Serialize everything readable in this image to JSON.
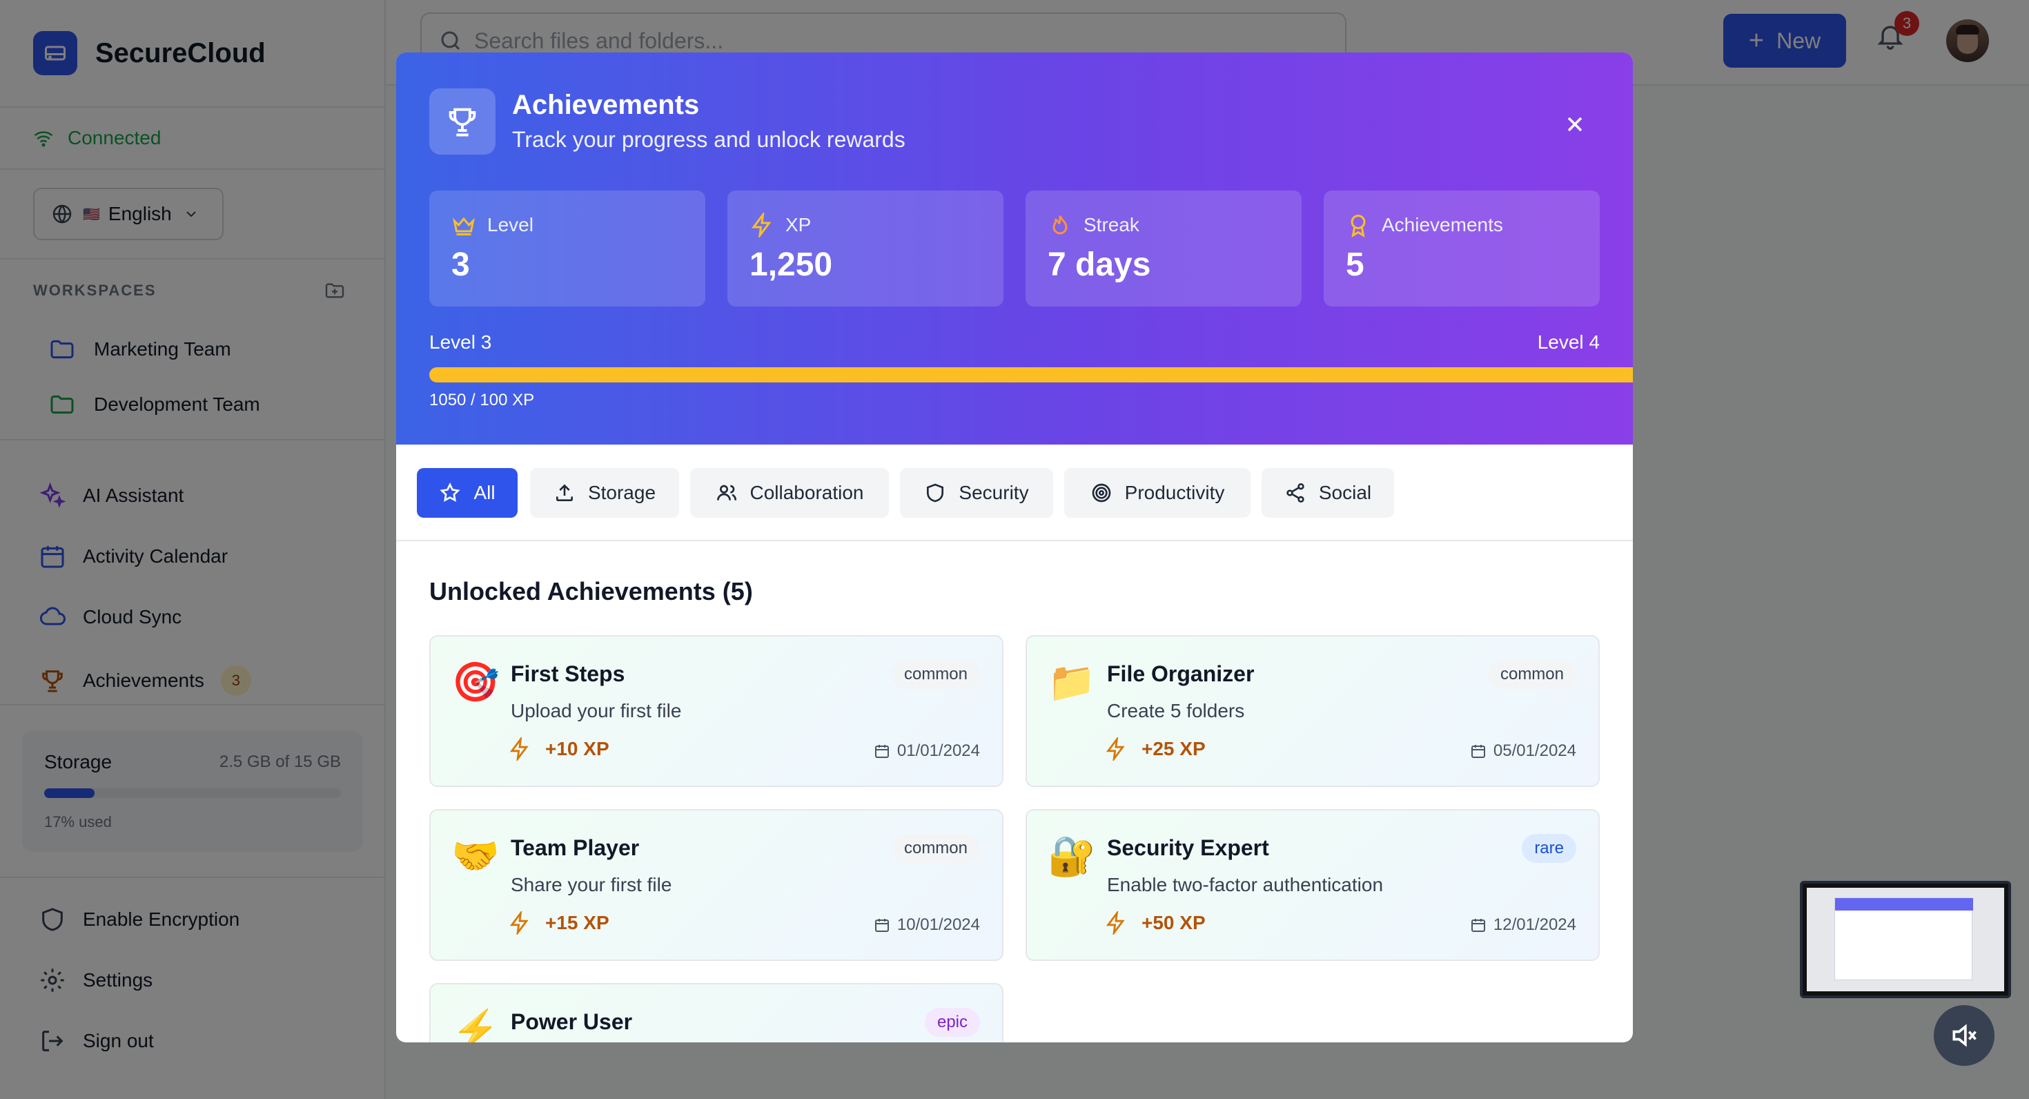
{
  "app": {
    "name": "SecureCloud",
    "connection": "Connected"
  },
  "language": {
    "flag": "🇺🇸",
    "label": "English"
  },
  "workspaces": {
    "header": "WORKSPACES",
    "items": [
      {
        "label": "Marketing Team",
        "color": "#2f54eb"
      },
      {
        "label": "Development Team",
        "color": "#16a34a"
      }
    ]
  },
  "nav": {
    "items": [
      {
        "label": "AI Assistant",
        "icon": "sparkles-icon"
      },
      {
        "label": "Activity Calendar",
        "icon": "calendar-icon"
      },
      {
        "label": "Cloud Sync",
        "icon": "cloud-icon"
      },
      {
        "label": "Achievements",
        "icon": "trophy-icon",
        "badge": "3"
      }
    ]
  },
  "storage": {
    "title": "Storage",
    "amount": "2.5 GB of 15 GB",
    "used_label": "17% used",
    "used_fraction": 0.17
  },
  "bottom_nav": {
    "items": [
      {
        "label": "Enable Encryption",
        "icon": "shield-icon"
      },
      {
        "label": "Settings",
        "icon": "gear-icon"
      },
      {
        "label": "Sign out",
        "icon": "sign-out-icon"
      }
    ]
  },
  "topbar": {
    "search_placeholder": "Search files and folders...",
    "new_label": "New",
    "notifications_count": "3"
  },
  "modal": {
    "title": "Achievements",
    "subtitle": "Track your progress and unlock rewards",
    "stats": [
      {
        "label": "Level",
        "value": "3",
        "icon": "crown-icon"
      },
      {
        "label": "XP",
        "value": "1,250",
        "icon": "lightning-icon"
      },
      {
        "label": "Streak",
        "value": "7 days",
        "icon": "flame-icon"
      },
      {
        "label": "Achievements",
        "value": "5",
        "icon": "award-icon"
      }
    ],
    "progress": {
      "current_level": "Level 3",
      "next_level": "Level 4",
      "text": "1050 / 100 XP",
      "fraction": 1.0
    },
    "tabs": [
      {
        "label": "All",
        "icon": "star-icon",
        "active": true
      },
      {
        "label": "Storage",
        "icon": "upload-icon"
      },
      {
        "label": "Collaboration",
        "icon": "users-icon"
      },
      {
        "label": "Security",
        "icon": "shield-icon"
      },
      {
        "label": "Productivity",
        "icon": "target-icon"
      },
      {
        "label": "Social",
        "icon": "share-icon"
      }
    ],
    "section_title": "Unlocked Achievements (5)",
    "achievements": [
      {
        "emoji": "🎯",
        "title": "First Steps",
        "desc": "Upload your first file",
        "xp": "+10 XP",
        "date": "01/01/2024",
        "rarity": "common"
      },
      {
        "emoji": "📁",
        "title": "File Organizer",
        "desc": "Create 5 folders",
        "xp": "+25 XP",
        "date": "05/01/2024",
        "rarity": "common"
      },
      {
        "emoji": "🤝",
        "title": "Team Player",
        "desc": "Share your first file",
        "xp": "+15 XP",
        "date": "10/01/2024",
        "rarity": "common"
      },
      {
        "emoji": "🔐",
        "title": "Security Expert",
        "desc": "Enable two-factor authentication",
        "xp": "+50 XP",
        "date": "12/01/2024",
        "rarity": "rare"
      },
      {
        "emoji": "⚡",
        "title": "Power User",
        "rarity": "epic"
      }
    ]
  }
}
